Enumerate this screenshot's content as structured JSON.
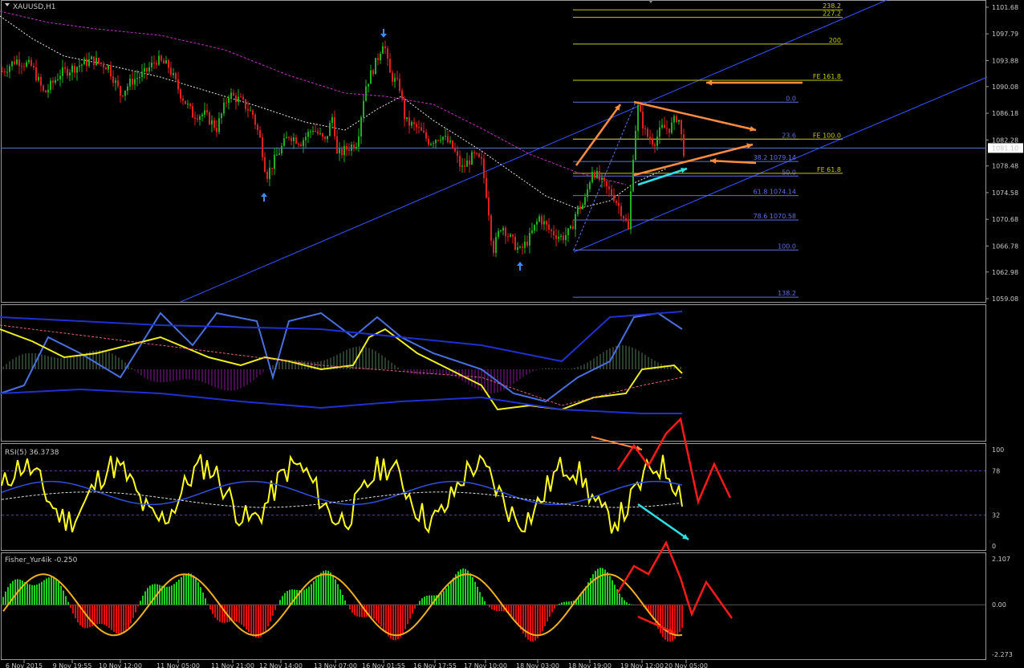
{
  "window_title": "XAUUSD,H1",
  "chart_data": [
    {
      "type": "candlestick",
      "title": "XAUUSD,H1",
      "y_ticks": [
        "1101.68",
        "1097.79",
        "1093.88",
        "1090.08",
        "1086.18",
        "1082.28",
        "1081.10",
        "1078.48",
        "1074.58",
        "1070.68",
        "1066.78",
        "1062.98",
        "1059.08"
      ],
      "current_price": "1081.10",
      "ylim": [
        1059.08,
        1101.68
      ],
      "fib_retracement_levels": [
        {
          "label": "0.0",
          "value": 1087.8
        },
        {
          "label": "23.6",
          "value": 1082.4
        },
        {
          "label": "38.2 1079.14",
          "value": 1079.14
        },
        {
          "label": "50.0",
          "value": 1077.0
        },
        {
          "label": "61.8 1074.14",
          "value": 1074.14
        },
        {
          "label": "78.6 1070.58",
          "value": 1070.58
        },
        {
          "label": "100.0",
          "value": 1066.2
        },
        {
          "label": "138.2",
          "value": 1059.3
        }
      ],
      "fib_expansion_levels": [
        {
          "label": "238.2",
          "value": 1101.3
        },
        {
          "label": "227.2",
          "value": 1100.2
        },
        {
          "label": "200",
          "value": 1096.3
        },
        {
          "label": "FE 161.8",
          "value": 1091.0
        },
        {
          "label": "FE 100.0",
          "value": 1082.4
        },
        {
          "label": "FE 61.8",
          "value": 1077.4
        }
      ],
      "price_path": [
        [
          0,
          1092
        ],
        [
          20,
          1094
        ],
        [
          40,
          1093
        ],
        [
          55,
          1089
        ],
        [
          75,
          1092
        ],
        [
          95,
          1093
        ],
        [
          115,
          1094
        ],
        [
          135,
          1093
        ],
        [
          150,
          1089
        ],
        [
          165,
          1091
        ],
        [
          180,
          1092
        ],
        [
          195,
          1094
        ],
        [
          210,
          1093
        ],
        [
          225,
          1089
        ],
        [
          240,
          1086
        ],
        [
          255,
          1086
        ],
        [
          270,
          1084
        ],
        [
          285,
          1089
        ],
        [
          300,
          1088
        ],
        [
          315,
          1086
        ],
        [
          325,
          1082
        ],
        [
          332,
          1077
        ],
        [
          345,
          1080
        ],
        [
          360,
          1083
        ],
        [
          375,
          1082
        ],
        [
          390,
          1084
        ],
        [
          405,
          1082
        ],
        [
          415,
          1086
        ],
        [
          420,
          1080
        ],
        [
          432,
          1081
        ],
        [
          445,
          1082
        ],
        [
          455,
          1090
        ],
        [
          470,
          1094
        ],
        [
          478,
          1097
        ],
        [
          485,
          1092
        ],
        [
          498,
          1090
        ],
        [
          505,
          1085
        ],
        [
          520,
          1084
        ],
        [
          535,
          1082
        ],
        [
          550,
          1083
        ],
        [
          565,
          1081
        ],
        [
          575,
          1078
        ],
        [
          590,
          1080
        ],
        [
          600,
          1079
        ],
        [
          608,
          1073
        ],
        [
          614,
          1066
        ],
        [
          625,
          1070
        ],
        [
          635,
          1068
        ],
        [
          648,
          1066
        ],
        [
          660,
          1068
        ],
        [
          672,
          1071
        ],
        [
          685,
          1069
        ],
        [
          700,
          1068
        ],
        [
          712,
          1069
        ],
        [
          718,
          1072
        ],
        [
          728,
          1073
        ],
        [
          738,
          1078
        ],
        [
          750,
          1076
        ],
        [
          765,
          1074
        ],
        [
          778,
          1071
        ],
        [
          783,
          1069
        ],
        [
          790,
          1082
        ],
        [
          795,
          1087
        ],
        [
          805,
          1083
        ],
        [
          815,
          1082
        ],
        [
          825,
          1084
        ],
        [
          835,
          1084
        ],
        [
          845,
          1086
        ],
        [
          850,
          1082
        ],
        [
          853,
          1080
        ]
      ],
      "arrows_down": [
        478
      ],
      "arrows_up": [
        329,
        648
      ]
    },
    {
      "type": "line",
      "title": "",
      "description_series": [
        "blue",
        "yellow",
        "purple histogram",
        "dark blue band"
      ]
    },
    {
      "type": "line",
      "title": "RSI(5) 36.3738",
      "ylim": [
        0,
        100
      ],
      "y_ticks": [
        "100",
        "78",
        "32",
        "0"
      ],
      "levels": [
        78,
        32
      ]
    },
    {
      "type": "bar",
      "title": "Fisher_Yur4ik -0.250",
      "y_ticks": [
        "2.107",
        "0.00",
        "-2.273"
      ],
      "ylim": [
        -2.273,
        2.107
      ]
    }
  ],
  "x_ticks": [
    "6 Nov 2015",
    "9 Nov 19:55",
    "10 Nov 12:00",
    "11 Nov 05:00",
    "11 Nov 21:00",
    "12 Nov 14:00",
    "13 Nov 07:00",
    "16 Nov 01:55",
    "16 Nov 17:55",
    "17 Nov 10:00",
    "18 Nov 03:00",
    "18 Nov 19:00",
    "19 Nov 12:00",
    "20 Nov 05:00"
  ],
  "colors": {
    "bull": "#22b022",
    "bear": "#e02020",
    "fib": "#c8c800",
    "fib_ret": "#6070e0",
    "channel": "#3355ff",
    "annot_orange": "#ff8c40",
    "annot_cyan": "#30e0e8",
    "annot_red": "#ff1a1a",
    "rsi": "#ffff20",
    "fisher_pos": "#20d020",
    "fisher_neg": "#e01010"
  }
}
